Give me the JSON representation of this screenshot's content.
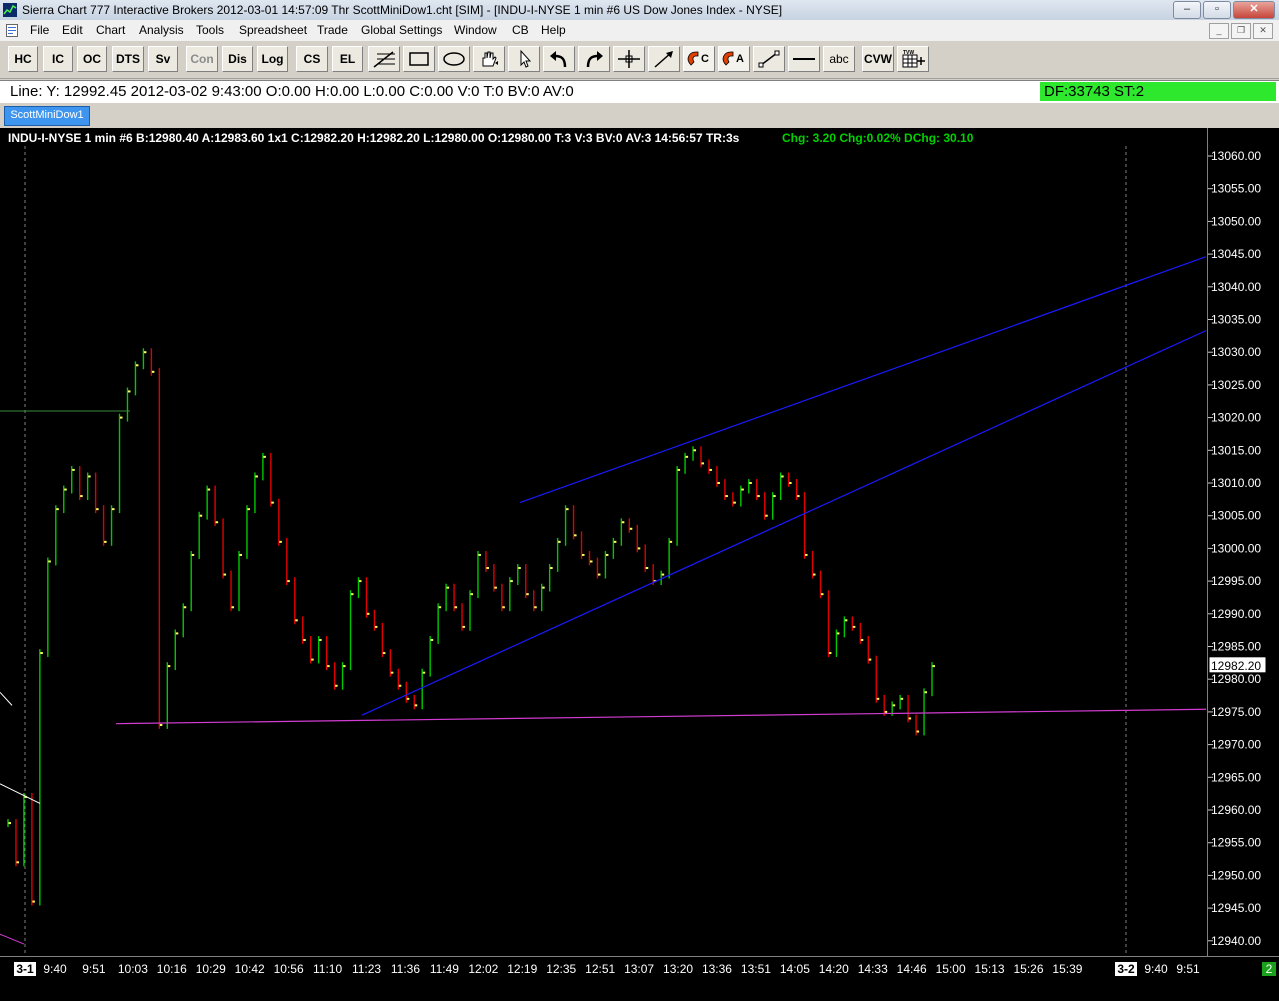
{
  "window": {
    "title": "Sierra Chart 777 Interactive Brokers 2012-03-01  14:57:09 Thr  ScottMiniDow1.cht [SIM] - [INDU-I-NYSE  1 min  #6  US Dow Jones Index - NYSE]",
    "minimize": "–",
    "restore": "▫",
    "close": "✕"
  },
  "menu": {
    "items": [
      "File",
      "Edit",
      "Chart",
      "Analysis",
      "Tools",
      "Spreadsheet",
      "Trade",
      "Global Settings",
      "Window",
      "CB",
      "Help"
    ]
  },
  "toolbar": {
    "hc": "HC",
    "ic": "IC",
    "oc": "OC",
    "dts": "DTS",
    "sv": "Sv",
    "con": "Con",
    "dis": "Dis",
    "log": "Log",
    "cs": "CS",
    "el": "EL",
    "abc": "abc",
    "cvw": "CVW"
  },
  "status": {
    "line_info": "Line: Y: 12992.45  2012-03-02  9:43:00  O:0.00  H:0.00  L:0.00  C:0.00  V:0  T:0  BV:0  AV:0",
    "df": "DF:33743  ST:2"
  },
  "chart_tab": {
    "label": "ScottMiniDow1"
  },
  "chart_header": {
    "info": "INDU-I-NYSE  1 min  #6 B:12980.40  A:12983.60  1x1  C:12982.20  H:12982.20  L:12980.00  O:12980.00  T:3  V:3  BV:0  AV:3  14:56:57  TR:3s",
    "chg": "Chg: 3.20  Chg:0.02%  DChg: 30.10"
  },
  "colors": {
    "background": "#000000",
    "up_bar": "#00c800",
    "down_bar": "#e00000",
    "close_tick": "#ffff64",
    "trendline": "#1a1aff",
    "support_line": "#d23cd2",
    "chg_text": "#00d200",
    "df_background": "#2ee82e"
  },
  "chart_data": {
    "type": "line",
    "ylim": [
      12937,
      13063
    ],
    "y_ticks": [
      "13060.00",
      "13055.00",
      "13050.00",
      "13045.00",
      "13040.00",
      "13035.00",
      "13030.00",
      "13025.00",
      "13020.00",
      "13015.00",
      "13010.00",
      "13005.00",
      "13000.00",
      "12995.00",
      "12990.00",
      "12985.00",
      "12980.00",
      "12975.00",
      "12970.00",
      "12965.00",
      "12960.00",
      "12955.00",
      "12950.00",
      "12945.00",
      "12940.00"
    ],
    "last_price_label": "12982.20",
    "last_price": 12982.2,
    "x_ticks": [
      "9:40",
      "9:51",
      "10:03",
      "10:16",
      "10:29",
      "10:42",
      "10:56",
      "11:10",
      "11:23",
      "11:36",
      "11:49",
      "12:02",
      "12:19",
      "12:35",
      "12:51",
      "13:07",
      "13:20",
      "13:36",
      "13:51",
      "14:05",
      "14:20",
      "14:33",
      "14:46",
      "15:00",
      "15:13",
      "15:26",
      "15:39",
      "9:40",
      "9:51"
    ],
    "day_markers": [
      "3-1",
      "3-2"
    ],
    "corner_label": "2",
    "series": [
      {
        "values": [
          12958,
          12952,
          12962,
          12946,
          12984,
          12998,
          13006,
          13009,
          13012,
          13008,
          13011,
          13006,
          13001,
          13006,
          13020,
          13024,
          13028,
          13030,
          13027,
          12973,
          12982,
          12987,
          12991,
          12999,
          13005,
          13009,
          13004,
          12996,
          12991,
          12999,
          13006,
          13011,
          13014,
          13007,
          13001,
          12995,
          12989,
          12986,
          12983,
          12986,
          12982,
          12979,
          12982,
          12993,
          12995,
          12990,
          12988,
          12984,
          12981,
          12979,
          12977,
          12976,
          12981,
          12986,
          12991,
          12994,
          12991,
          12988,
          12993,
          12999,
          12997,
          12994,
          12991,
          12995,
          12997,
          12993,
          12991,
          12994,
          12997,
          13001,
          13006,
          13002,
          12999,
          12998,
          12996,
          12999,
          13001,
          13004,
          13003,
          13000,
          12997,
          12995,
          12996,
          13001,
          13012,
          13014,
          13015,
          13013,
          13012,
          13010,
          13008,
          13007,
          13009,
          13010,
          13008,
          13005,
          13008,
          13011,
          13010,
          13008,
          12999,
          12996,
          12993,
          12984,
          12987,
          12989,
          12988,
          12986,
          12983,
          12977,
          12975,
          12976,
          12977,
          12974,
          12972,
          12978,
          12982
        ]
      }
    ]
  }
}
